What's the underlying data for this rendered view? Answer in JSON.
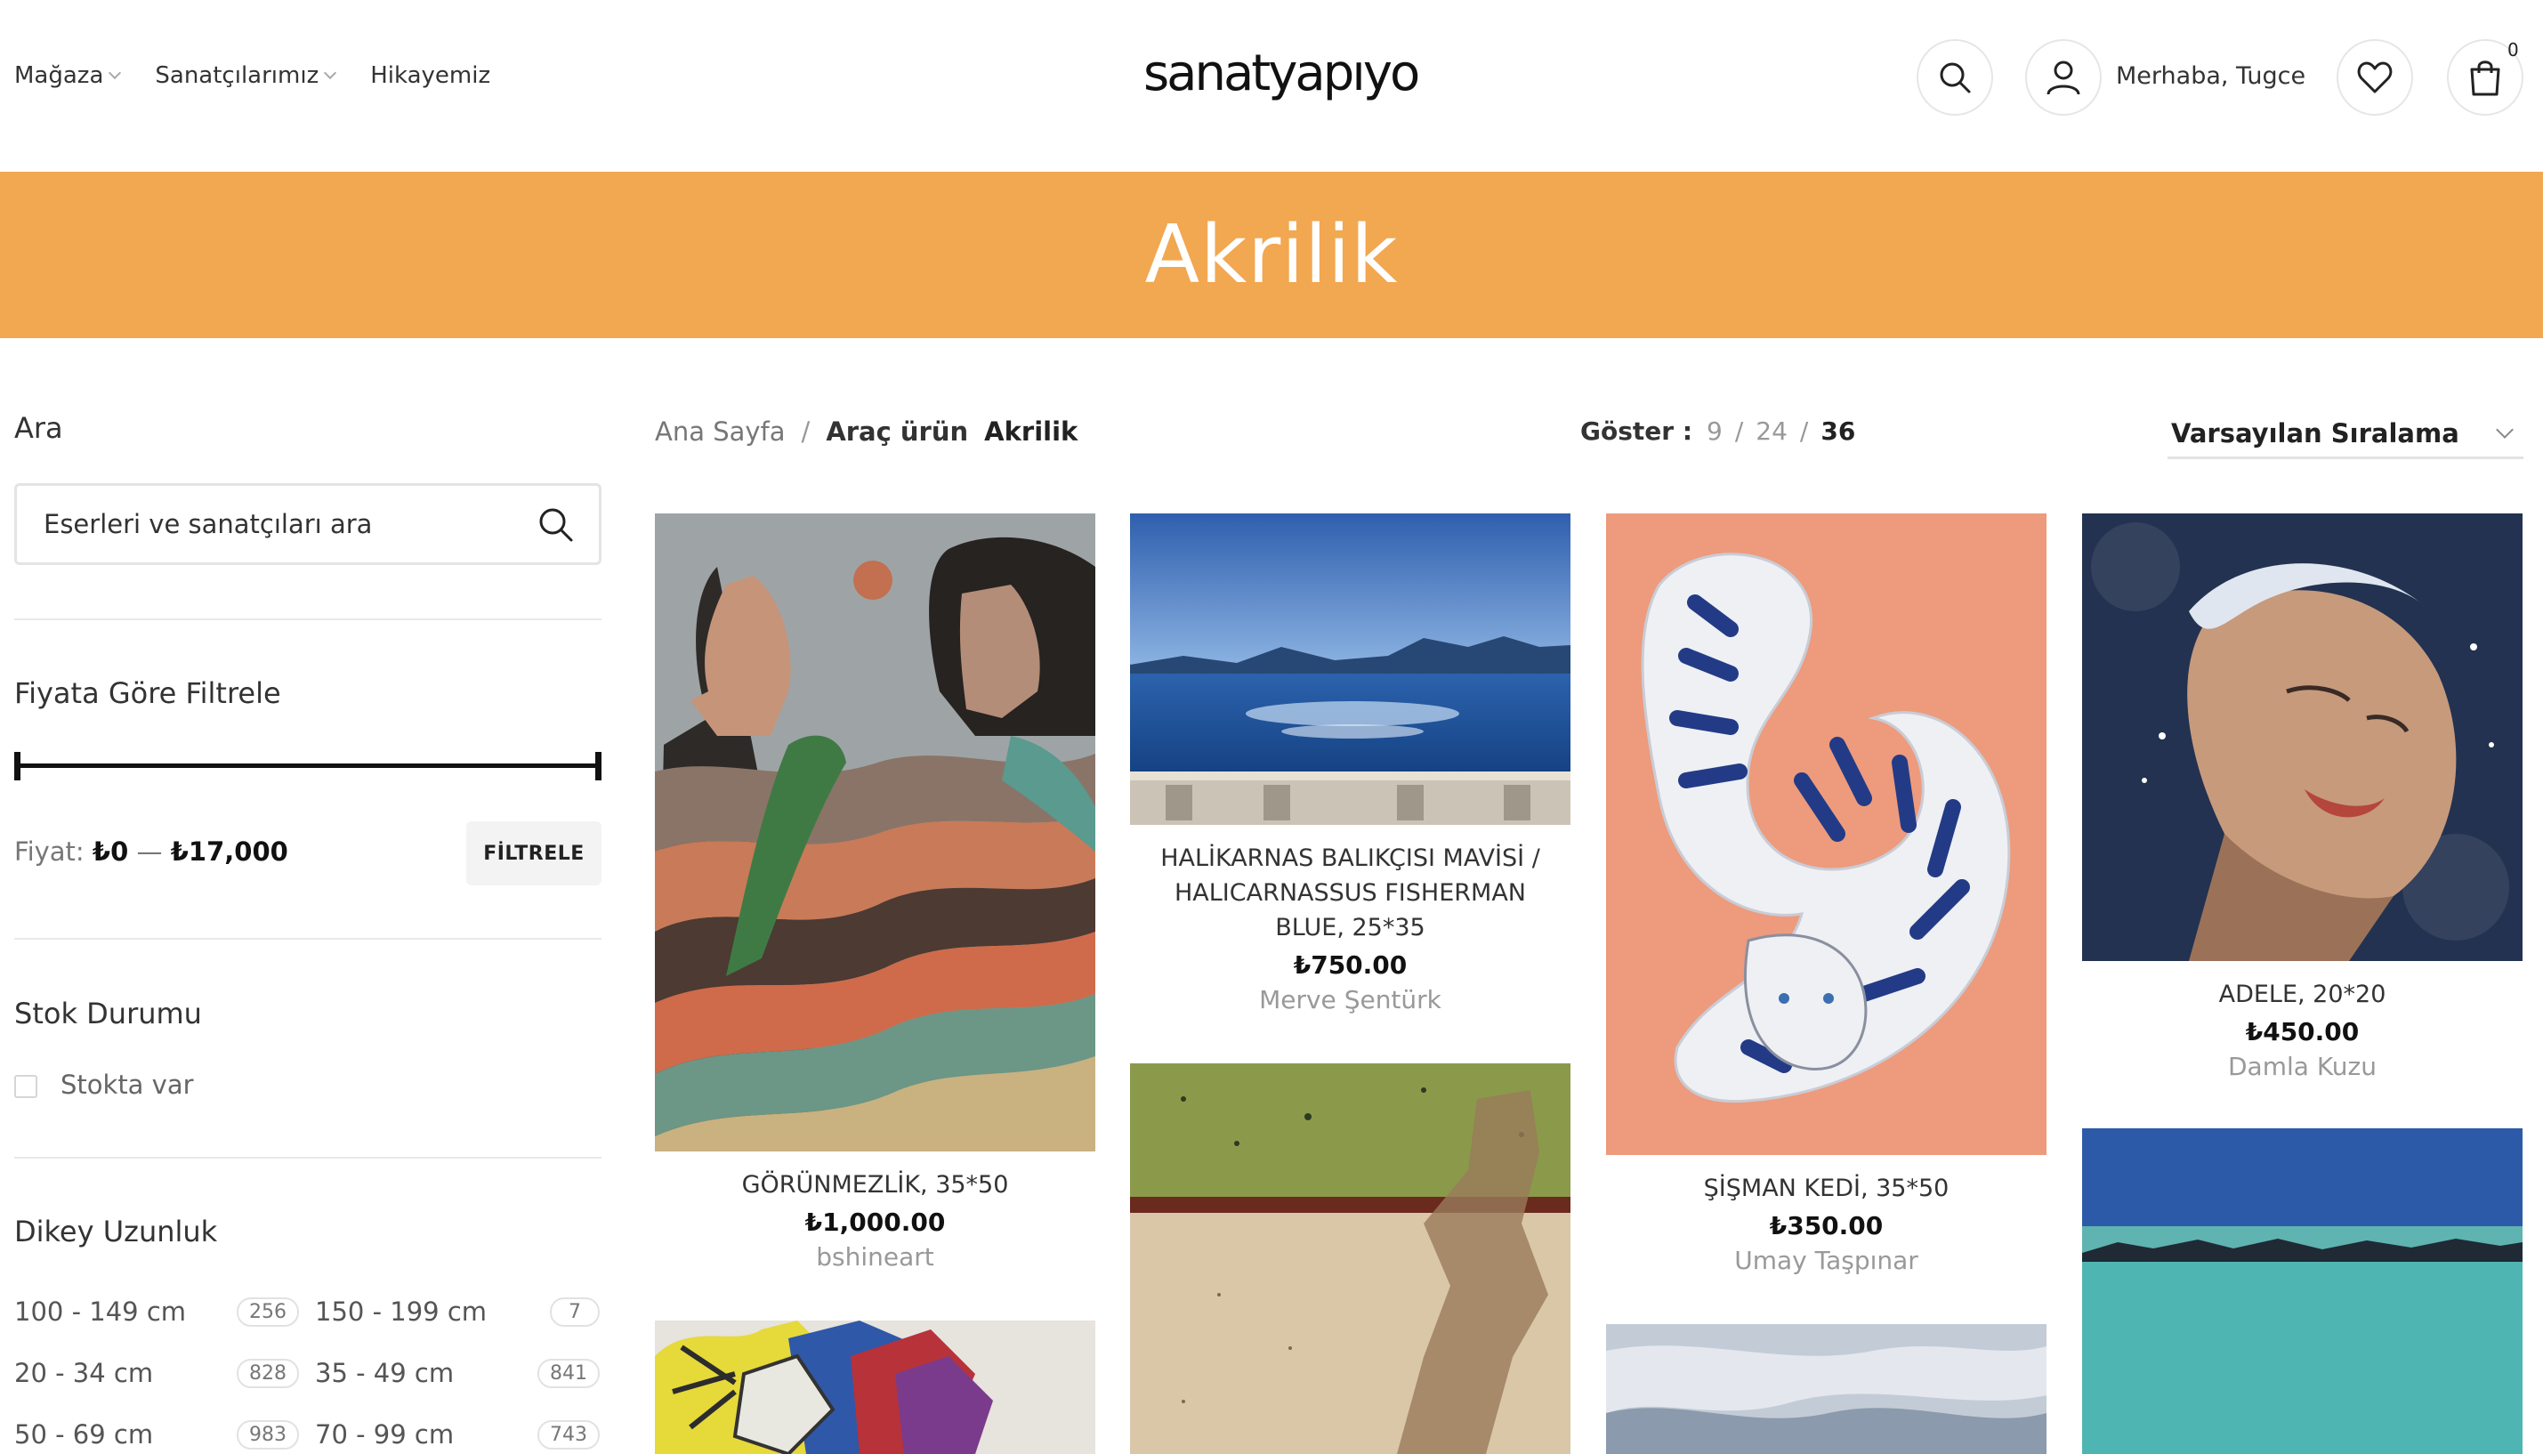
{
  "header": {
    "nav": [
      {
        "label": "Mağaza",
        "dropdown": true
      },
      {
        "label": "Sanatçılarımız",
        "dropdown": true
      },
      {
        "label": "Hikayemiz",
        "dropdown": false
      }
    ],
    "logo": "sanatyapıyo",
    "greeting": "Merhaba, Tugce",
    "cart_count": "0",
    "icons": [
      "search-icon",
      "user-icon",
      "heart-icon",
      "bag-icon"
    ]
  },
  "banner": {
    "title": "Akrilik",
    "color": "#f2a751"
  },
  "sidebar": {
    "search": {
      "title": "Ara",
      "placeholder": "Eserleri ve sanatçıları ara"
    },
    "price_filter": {
      "title": "Fiyata Göre Filtrele",
      "price_label": "Fiyat:",
      "min": "₺0",
      "dash": "—",
      "max": "₺17,000",
      "button": "FİLTRELE",
      "range_fraction": [
        0,
        1
      ]
    },
    "stock": {
      "title": "Stok Durumu",
      "option": "Stokta var",
      "checked": false
    },
    "vertical_length": {
      "title": "Dikey Uzunluk",
      "options": [
        {
          "label": "100 - 149 cm",
          "count": "256"
        },
        {
          "label": "150 - 199 cm",
          "count": "7"
        },
        {
          "label": "20 - 34 cm",
          "count": "828"
        },
        {
          "label": "35 - 49 cm",
          "count": "841"
        },
        {
          "label": "50 - 69 cm",
          "count": "983"
        },
        {
          "label": "70 - 99 cm",
          "count": "743"
        }
      ]
    }
  },
  "toolbar": {
    "breadcrumb": {
      "home": "Ana Sayfa",
      "sep": "/",
      "parent": "Araç ürün",
      "current": "Akrilik"
    },
    "show": {
      "label": "Göster :",
      "options": [
        "9",
        "24",
        "36"
      ],
      "active": "36"
    },
    "grid_views": [
      "grid-2-icon",
      "grid-3-icon",
      "grid-4-icon",
      "grid-5-icon"
    ],
    "active_grid": "grid-4-icon",
    "sort": "Varsayılan Sıralama"
  },
  "products": [
    {
      "title": "GÖRÜNMEZLİK, 35*50",
      "price": "₺1,000.00",
      "artist": "bshineart"
    },
    {
      "title": "HALİKARNAS BALIKÇISI MAVİSİ / HALICARNASSUS FISHERMAN BLUE, 25*35",
      "price": "₺750.00",
      "artist": "Merve Şentürk"
    },
    {
      "title": "ŞİŞMAN KEDİ, 35*50",
      "price": "₺350.00",
      "artist": "Umay Taşpınar"
    },
    {
      "title": "ADELE, 20*20",
      "price": "₺450.00",
      "artist": "Damla Kuzu"
    }
  ]
}
